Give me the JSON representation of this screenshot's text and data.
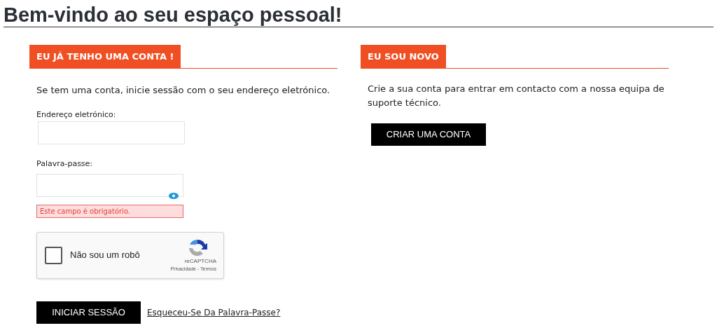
{
  "title": "Bem-vindo ao seu espaço pessoal!",
  "login": {
    "heading": "EU JÁ TENHO UMA CONTA !",
    "intro": "Se tem uma conta, inicie sessão com o seu endereço eletrónico.",
    "email_label": "Endereço eletrónico:",
    "password_label": "Palavra-passe:",
    "password_error": "Este campo é obrigatório.",
    "captcha": {
      "label": "Não sou um robô",
      "checked": false,
      "brand": "reCAPTCHA",
      "links": "Privacidade - Termos"
    },
    "submit": "INICIAR SESSÃO",
    "forgot": "Esqueceu-Se Da Palavra-Passe?"
  },
  "register": {
    "heading": "EU SOU NOVO",
    "intro": "Crie a sua conta para entrar em contacto com a nossa equipa de suporte técnico.",
    "button": "CRIAR UMA CONTA"
  }
}
